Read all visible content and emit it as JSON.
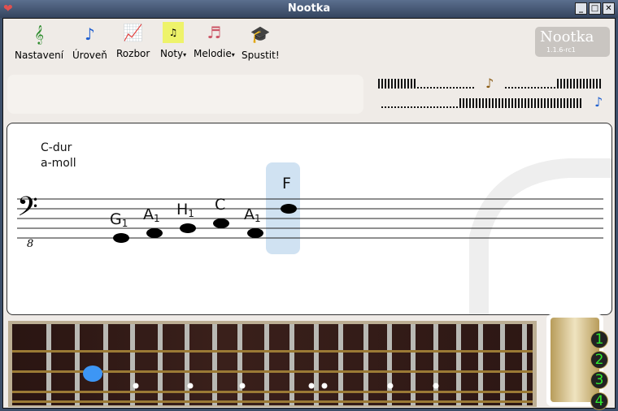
{
  "window": {
    "title": "Nootka"
  },
  "toolbar": [
    {
      "label": "Nastavení",
      "icon": "settings-icon"
    },
    {
      "label": "Úroveň",
      "icon": "level-icon"
    },
    {
      "label": "Rozbor",
      "icon": "analyze-icon"
    },
    {
      "label": "Noty",
      "icon": "notes-icon",
      "menu": true
    },
    {
      "label": "Melodie",
      "icon": "melody-icon",
      "menu": true
    },
    {
      "label": "Spustit!",
      "icon": "start-icon"
    }
  ],
  "logo": {
    "name": "Nootka",
    "version": "1.1.6-rc1"
  },
  "score": {
    "key_major": "C-dur",
    "key_minor": "a-moll",
    "clef_octave": "8",
    "notes": [
      {
        "name": "G",
        "sub": "1",
        "step": -4
      },
      {
        "name": "A",
        "sub": "1",
        "step": -3
      },
      {
        "name": "H",
        "sub": "1",
        "step": -2
      },
      {
        "name": "C",
        "sub": "",
        "step": -1
      },
      {
        "name": "A",
        "sub": "1",
        "step": -3
      },
      {
        "name": "F",
        "sub": "",
        "step": 2,
        "highlighted": true
      }
    ]
  },
  "fretboard": {
    "strings": [
      "1",
      "2",
      "3",
      "4"
    ],
    "selected": {
      "string": 2,
      "fret": 2
    },
    "marker_color": "#3d96f5"
  }
}
